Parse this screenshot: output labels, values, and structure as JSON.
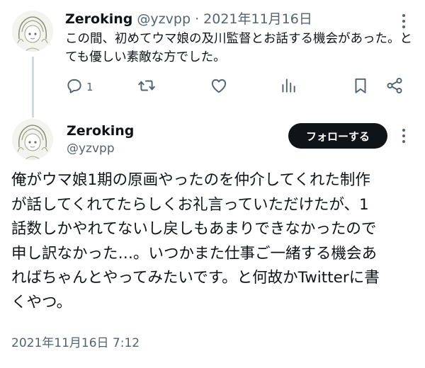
{
  "reply_tweet": {
    "display_name": "Zeroking",
    "handle": "@yzvpp",
    "separator": "·",
    "date": "2021年11月16日",
    "text": "この間、初めてウマ娘の及川監督とお話する機会があった。とても優しい素敵な方でした。",
    "actions": {
      "reply_count": "1",
      "reply_icon": "comment-icon",
      "retweet_icon": "retweet-icon",
      "like_icon": "heart-icon",
      "views_icon": "bar-chart-icon",
      "bookmark_icon": "bookmark-icon",
      "share_icon": "share-icon"
    }
  },
  "main_tweet": {
    "display_name": "Zeroking",
    "handle": "@yzvpp",
    "follow_label": "フォローする",
    "text": "俺がウマ娘1期の原画やったのを仲介してくれた制作\nが話してくれてたらしくお礼言っていただけたが、1\n話数しかやれてないし戻しもあまりできなかったので\n申し訳なかった…。いつかまた仕事ご一緒する機会あ\nればちゃんとやってみたいです。と何故かTwitterに書\nくやつ。",
    "timestamp": "2021年11月16日 7:12"
  },
  "colors": {
    "text_primary": "#0f1419",
    "text_secondary": "#536471",
    "thread_line": "#cfd9de",
    "follow_button_bg": "#0f1419",
    "follow_button_text": "#ffffff"
  }
}
